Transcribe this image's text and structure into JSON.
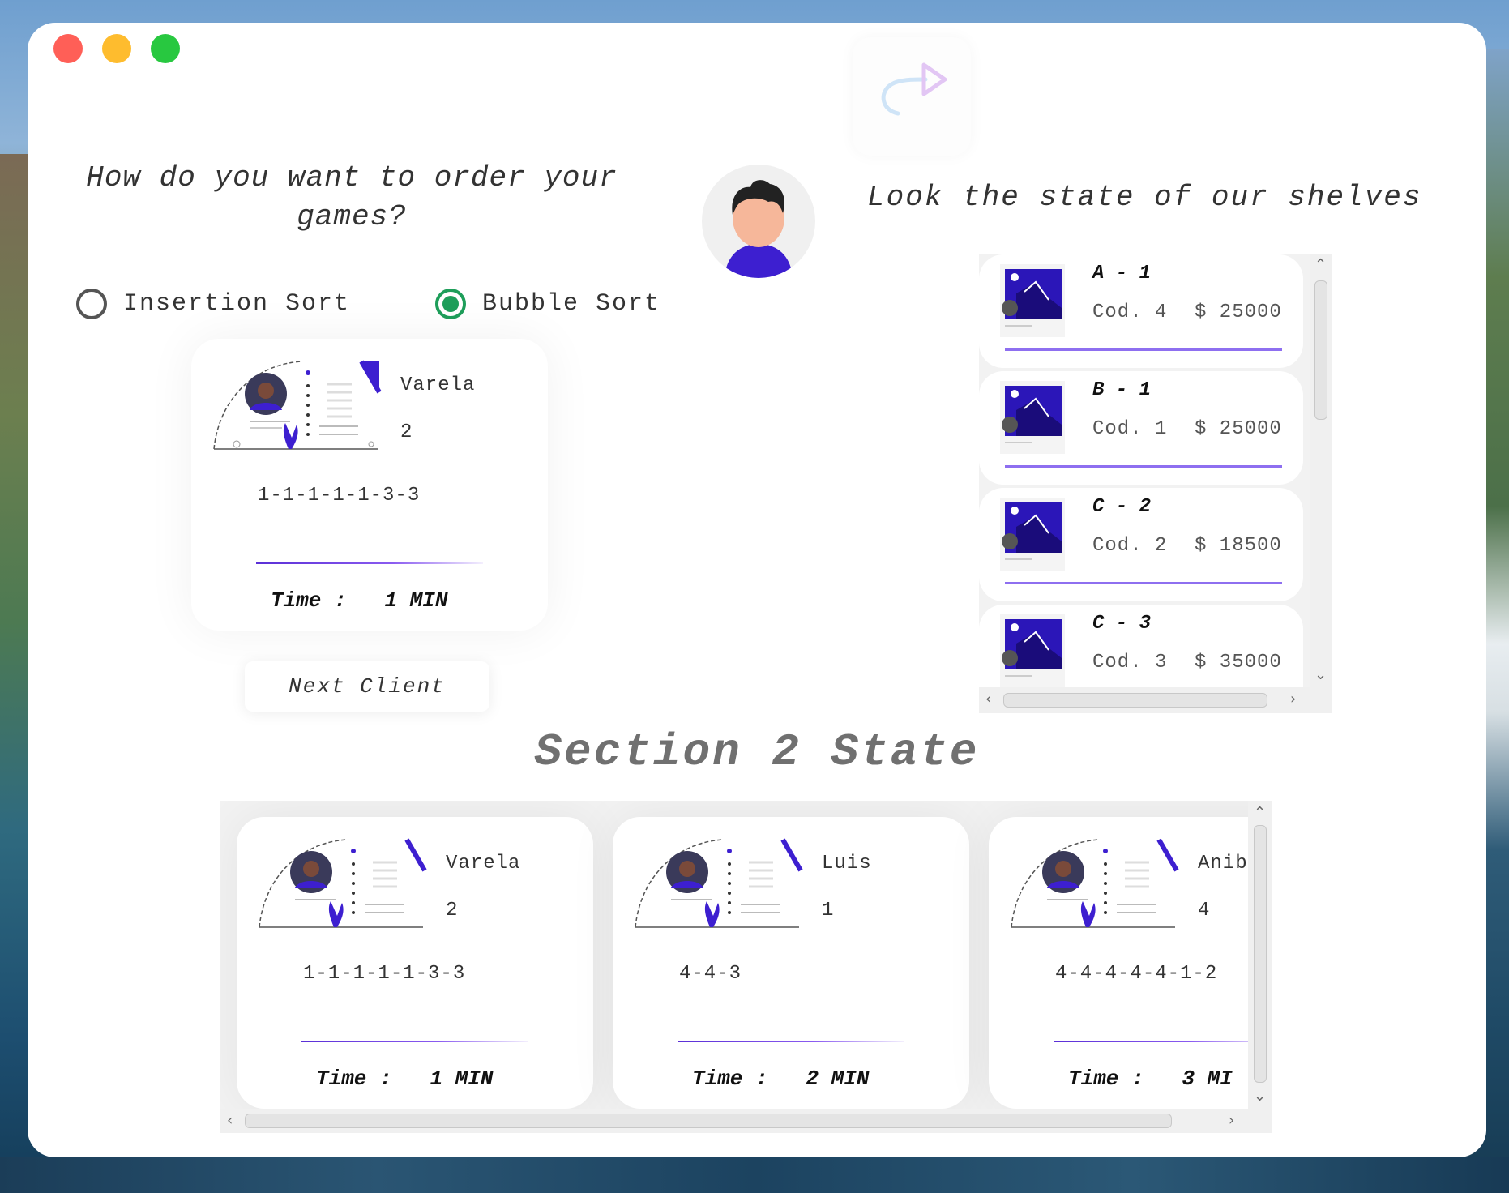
{
  "window": {
    "controls": [
      "close",
      "minimize",
      "maximize"
    ],
    "redo_icon": "redo-arrow-icon"
  },
  "order": {
    "question": "How do you want to order your games?",
    "options": [
      {
        "label": "Insertion Sort",
        "checked": false
      },
      {
        "label": "Bubble Sort",
        "checked": true
      }
    ]
  },
  "current_client": {
    "name": "Varela",
    "count": "2",
    "sequence": "1-1-1-1-1-3-3",
    "time_label": "Time :",
    "time_value": "1 MIN"
  },
  "next_client_label": "Next Client",
  "shelves": {
    "title": "Look the state of our shelves",
    "items": [
      {
        "position": "A - 1",
        "code": "Cod. 4",
        "price": "$ 25000"
      },
      {
        "position": "B - 1",
        "code": "Cod. 1",
        "price": "$ 25000"
      },
      {
        "position": "C - 2",
        "code": "Cod. 2",
        "price": "$ 18500"
      },
      {
        "position": "C - 3",
        "code": "Cod. 3",
        "price": "$ 35000"
      }
    ]
  },
  "section": {
    "title": "Section 2 State",
    "clients": [
      {
        "name": "Varela",
        "count": "2",
        "sequence": "1-1-1-1-1-3-3",
        "time_label": "Time :",
        "time_value": "1 MIN"
      },
      {
        "name": "Luis",
        "count": "1",
        "sequence": "4-4-3",
        "time_label": "Time :",
        "time_value": "2 MIN"
      },
      {
        "name": "Anib",
        "count": "4",
        "sequence": "4-4-4-4-4-1-2",
        "time_label": "Time :",
        "time_value": "3 MI"
      }
    ]
  },
  "colors": {
    "accent": "#1e9e5a",
    "purple": "#3d1fd0",
    "line": "#8e6ff0"
  }
}
